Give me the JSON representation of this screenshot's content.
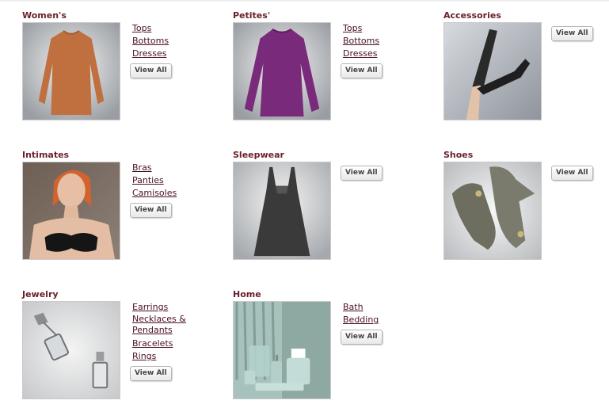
{
  "categories": [
    {
      "title": "Women's",
      "links": [
        "Tops",
        "Bottoms",
        "Dresses"
      ],
      "view_all": "View All"
    },
    {
      "title": "Petites'",
      "links": [
        "Tops",
        "Bottoms",
        "Dresses"
      ],
      "view_all": "View All"
    },
    {
      "title": "Accessories",
      "links": [],
      "view_all": "View All"
    },
    {
      "title": "Intimates",
      "links": [
        "Bras",
        "Panties",
        "Camisoles"
      ],
      "view_all": "View All"
    },
    {
      "title": "Sleepwear",
      "links": [],
      "view_all": "View All"
    },
    {
      "title": "Shoes",
      "links": [],
      "view_all": "View All"
    },
    {
      "title": "Jewelry",
      "links": [
        "Earrings",
        "Necklaces &",
        "Pendants",
        "Bracelets",
        "Rings"
      ],
      "view_all": "View All"
    },
    {
      "title": "Home",
      "links": [
        "Bath",
        "Bedding"
      ],
      "view_all": "View All"
    }
  ],
  "colors": {
    "title": "#6b1f2a",
    "link": "#4a1020"
  }
}
